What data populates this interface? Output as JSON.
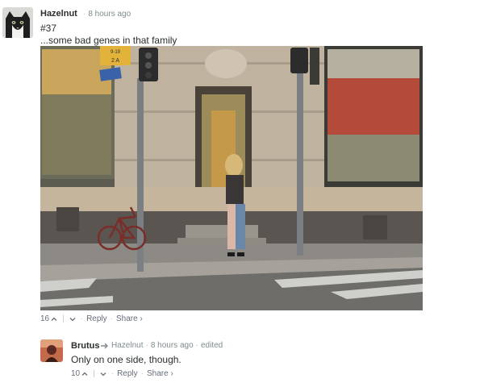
{
  "comments": [
    {
      "author": "Hazelnut",
      "time": "8 hours ago",
      "lines": [
        "#37",
        "...some bad genes in that family"
      ],
      "votes": "16",
      "reply_label": "Reply",
      "share_label": "Share ›"
    },
    {
      "author": "Brutus",
      "in_reply_to": "Hazelnut",
      "time": "8 hours ago",
      "edited": "edited",
      "text": "Only on one side, though.",
      "votes": "10",
      "reply_label": "Reply",
      "share_label": "Share ›"
    }
  ],
  "photo_signs": {
    "street_sign_top": "9-19",
    "street_sign_bottom": "2 A"
  },
  "icons": [
    "avatar-cat-icon",
    "upvote-icon",
    "downvote-icon",
    "reply-arrow-icon"
  ],
  "colors": {
    "author": "#2a2e2e",
    "meta": "#7f8c8d",
    "footer": "#656c7a"
  }
}
